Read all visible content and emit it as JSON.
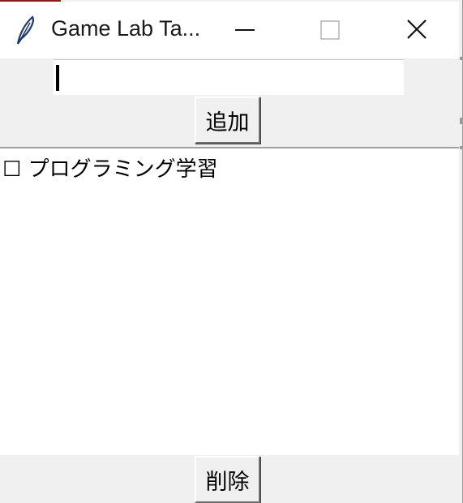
{
  "window": {
    "title": "Game Lab Ta...",
    "icon": "feather-icon",
    "controls": [
      "minimize-icon",
      "maximize-icon",
      "close-icon"
    ]
  },
  "input": {
    "value": "",
    "placeholder": ""
  },
  "buttons": {
    "add_label": "追加",
    "delete_label": "削除"
  },
  "list": {
    "items": [
      {
        "label": "☐ プログラミング学習"
      }
    ]
  },
  "colors": {
    "accent": "#8b1a1a",
    "window_bg": "#f0f0f0",
    "list_bg": "#ffffff"
  }
}
